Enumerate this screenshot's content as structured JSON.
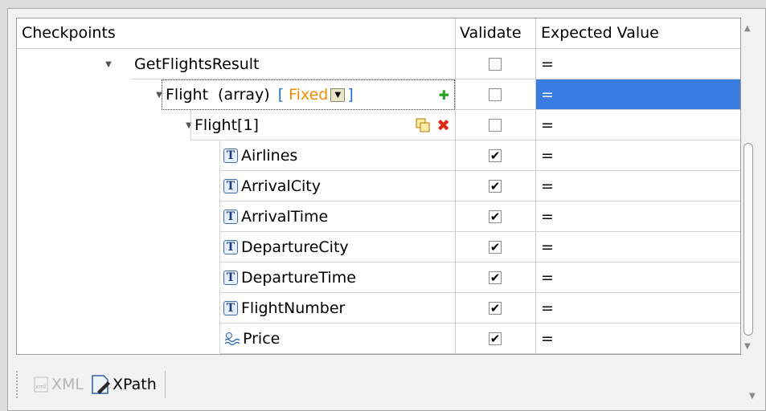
{
  "header": {
    "checkpoints": "Checkpoints",
    "validate": "Validate",
    "expected_value": "Expected Value"
  },
  "rows": [
    {
      "name": "GetFlightsResult",
      "validate": false,
      "expected": "="
    },
    {
      "name": "Flight",
      "type_label": "(array)",
      "open_bracket": "[",
      "mode": "Fixed",
      "close_bracket": "]",
      "validate": false,
      "expected": "=",
      "selected": true
    },
    {
      "name": "Flight[1]",
      "validate": false,
      "expected": "="
    },
    {
      "name": "Airlines",
      "icon": "text-type-icon",
      "validate": true,
      "expected": "="
    },
    {
      "name": "ArrivalCity",
      "icon": "text-type-icon",
      "validate": true,
      "expected": "="
    },
    {
      "name": "ArrivalTime",
      "icon": "text-type-icon",
      "validate": true,
      "expected": "="
    },
    {
      "name": "DepartureCity",
      "icon": "text-type-icon",
      "validate": true,
      "expected": "="
    },
    {
      "name": "DepartureTime",
      "icon": "text-type-icon",
      "validate": true,
      "expected": "="
    },
    {
      "name": "FlightNumber",
      "icon": "text-type-icon",
      "validate": true,
      "expected": "="
    },
    {
      "name": "Price",
      "icon": "numeric-type-icon",
      "validate": true,
      "expected": "="
    }
  ],
  "toolbar": {
    "xml_label": "XML",
    "xpath_label": "XPath"
  },
  "icons": {
    "text_type_glyph": "T",
    "check_glyph": "✔"
  },
  "colors": {
    "selection": "#3b7ce0",
    "fixed_text": "#f08c00",
    "bracket": "#1e6fd0"
  }
}
